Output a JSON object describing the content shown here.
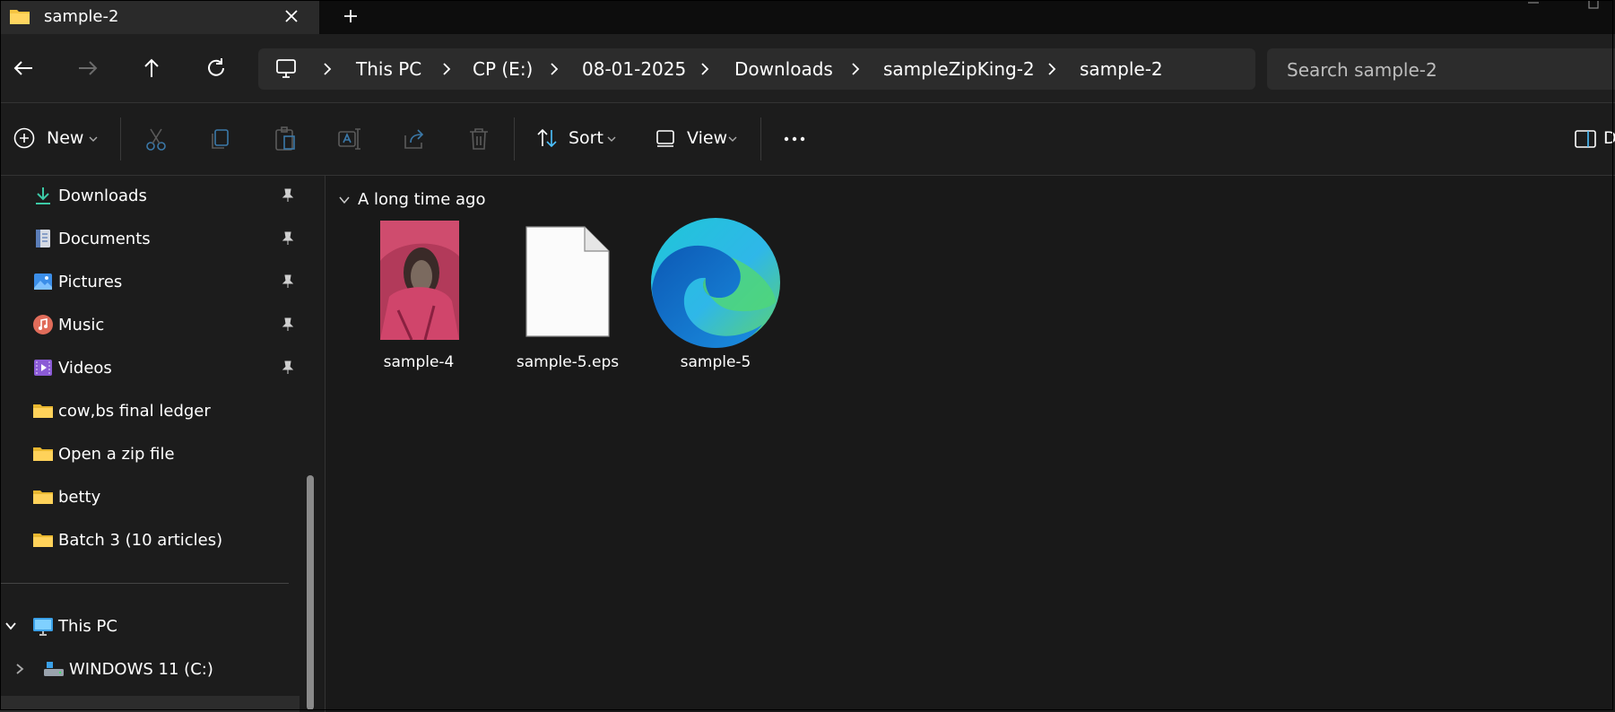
{
  "window": {
    "tab_title": "sample-2"
  },
  "nav": {
    "breadcrumbs": [
      "This PC",
      "CP (E:)",
      "08-01-2025",
      "Downloads",
      "sampleZipKing-2",
      "sample-2"
    ],
    "search_placeholder": "Search sample-2"
  },
  "toolbar": {
    "new_label": "New",
    "sort_label": "Sort",
    "view_label": "View",
    "details_label": "D"
  },
  "sidebar": {
    "quick_access": [
      {
        "label": "Downloads",
        "icon": "download-icon",
        "pinned": true
      },
      {
        "label": "Documents",
        "icon": "documents-icon",
        "pinned": true
      },
      {
        "label": "Pictures",
        "icon": "pictures-icon",
        "pinned": true
      },
      {
        "label": "Music",
        "icon": "music-icon",
        "pinned": true
      },
      {
        "label": "Videos",
        "icon": "videos-icon",
        "pinned": true
      },
      {
        "label": "cow,bs final ledger",
        "icon": "folder-icon",
        "pinned": false
      },
      {
        "label": "Open a zip file",
        "icon": "folder-icon",
        "pinned": false
      },
      {
        "label": "betty",
        "icon": "folder-icon",
        "pinned": false
      },
      {
        "label": "Batch 3 (10 articles)",
        "icon": "folder-icon",
        "pinned": false
      }
    ],
    "this_pc_label": "This PC",
    "drive_label": "WINDOWS 11 (C:)"
  },
  "content": {
    "group_label": "A long time ago",
    "files": [
      {
        "name": "sample-4",
        "icon": "image-thumbnail"
      },
      {
        "name": "sample-5.eps",
        "icon": "blank-file-icon"
      },
      {
        "name": "sample-5",
        "icon": "edge-browser-icon"
      }
    ]
  },
  "colors": {
    "background": "#191919",
    "folder": "#f5c542",
    "accent": "#4cc2ff"
  }
}
